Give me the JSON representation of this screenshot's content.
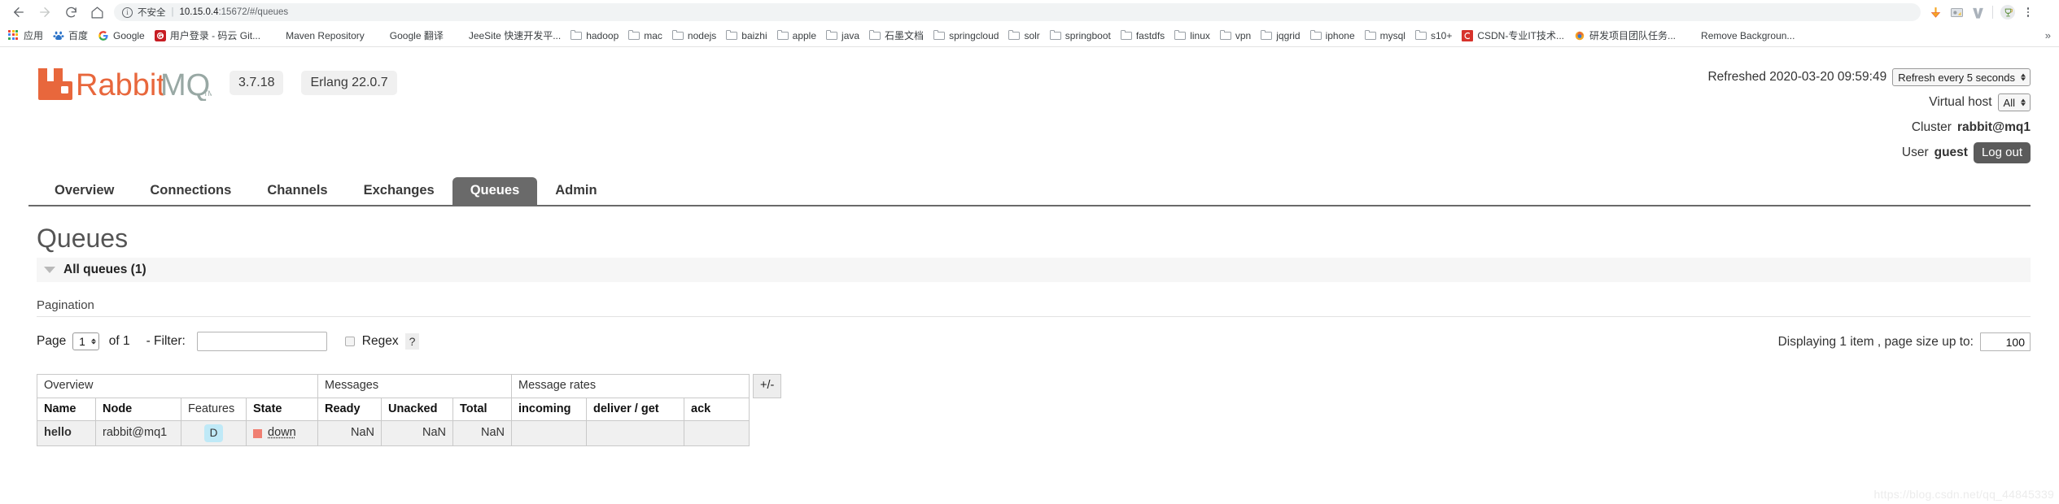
{
  "browser": {
    "nav": {
      "back_icon": "back-arrow-icon",
      "forward_icon": "forward-arrow-icon",
      "reload_icon": "reload-icon",
      "home_icon": "home-icon"
    },
    "omnibox": {
      "info_glyph": "ⓘ",
      "security_label": "不安全",
      "separator": "|",
      "url_host": "10.15.0.4",
      "url_rest": ":15672/#/queues",
      "full_url": "10.15.0.4:15672/#/queues"
    },
    "bookmarks": [
      {
        "label": "应用",
        "icon": "apps-grid-icon"
      },
      {
        "label": "百度",
        "icon": "baidu-icon"
      },
      {
        "label": "Google",
        "icon": "google-icon"
      },
      {
        "label": "用户登录 - 码云 Git...",
        "icon": "gitee-icon"
      },
      {
        "label": "Maven Repository",
        "icon": "globe-icon"
      },
      {
        "label": "Google 翻译",
        "icon": "globe-icon"
      },
      {
        "label": "JeeSite 快速开发平...",
        "icon": "globe-icon"
      },
      {
        "label": "hadoop",
        "icon": "folder-icon"
      },
      {
        "label": "mac",
        "icon": "folder-icon"
      },
      {
        "label": "nodejs",
        "icon": "folder-icon"
      },
      {
        "label": "baizhi",
        "icon": "folder-icon"
      },
      {
        "label": "apple",
        "icon": "folder-icon"
      },
      {
        "label": "java",
        "icon": "folder-icon"
      },
      {
        "label": "石墨文档",
        "icon": "folder-icon"
      },
      {
        "label": "springcloud",
        "icon": "folder-icon"
      },
      {
        "label": "solr",
        "icon": "folder-icon"
      },
      {
        "label": "springboot",
        "icon": "folder-icon"
      },
      {
        "label": "fastdfs",
        "icon": "folder-icon"
      },
      {
        "label": "linux",
        "icon": "folder-icon"
      },
      {
        "label": "vpn",
        "icon": "folder-icon"
      },
      {
        "label": "jqgrid",
        "icon": "folder-icon"
      },
      {
        "label": "iphone",
        "icon": "folder-icon"
      },
      {
        "label": "mysql",
        "icon": "folder-icon"
      },
      {
        "label": "s10+",
        "icon": "folder-icon"
      },
      {
        "label": "CSDN-专业IT技术...",
        "icon": "csdn-icon"
      },
      {
        "label": "研发项目团队任务...",
        "icon": "firefox-icon"
      },
      {
        "label": "Remove Backgroun...",
        "icon": "globe-icon"
      }
    ],
    "bookmarks_overflow": "»"
  },
  "brand": {
    "name": "RabbitMQ",
    "trademark": "TM",
    "version": "3.7.18",
    "erlang": "Erlang 22.0.7",
    "logo_color": "#e8673c",
    "logo_gray": "#8b9a97"
  },
  "status": {
    "refreshed_label": "Refreshed 2020-03-20 09:59:49",
    "refresh_interval": "Refresh every 5 seconds",
    "vhost_label": "Virtual host",
    "vhost_value": "All",
    "cluster_label": "Cluster",
    "cluster_value": "rabbit@mq1",
    "user_label": "User",
    "user_value": "guest",
    "logout_label": "Log out"
  },
  "tabs": [
    {
      "label": "Overview",
      "active": false
    },
    {
      "label": "Connections",
      "active": false
    },
    {
      "label": "Channels",
      "active": false
    },
    {
      "label": "Exchanges",
      "active": false
    },
    {
      "label": "Queues",
      "active": true
    },
    {
      "label": "Admin",
      "active": false
    }
  ],
  "main": {
    "page_title": "Queues",
    "section_title": "All queues (1)",
    "pagination_label": "Pagination",
    "page_label": "Page",
    "page_value": "1",
    "of_label": "of 1",
    "filter_label": "- Filter:",
    "filter_value": "",
    "filter_placeholder": "",
    "regex_label": "Regex",
    "help_label": "?",
    "displaying_label": "Displaying 1 item , page size up to:",
    "page_size_value": "100",
    "plus_minus": "+/-"
  },
  "table": {
    "group_headers": [
      {
        "label": "Overview",
        "span": 4
      },
      {
        "label": "Messages",
        "span": 3
      },
      {
        "label": "Message rates",
        "span": 3
      }
    ],
    "columns": [
      {
        "label": "Name",
        "bold": true
      },
      {
        "label": "Node",
        "bold": true
      },
      {
        "label": "Features",
        "bold": false
      },
      {
        "label": "State",
        "bold": true
      },
      {
        "label": "Ready",
        "bold": true
      },
      {
        "label": "Unacked",
        "bold": true
      },
      {
        "label": "Total",
        "bold": true
      },
      {
        "label": "incoming",
        "bold": true
      },
      {
        "label": "deliver / get",
        "bold": true
      },
      {
        "label": "ack",
        "bold": true
      }
    ],
    "rows": [
      {
        "name": "hello",
        "node": "rabbit@mq1",
        "features": "D",
        "state": "down",
        "state_color": "#f07f72",
        "ready": "NaN",
        "unacked": "NaN",
        "total": "NaN",
        "incoming": "",
        "deliver_get": "",
        "ack": ""
      }
    ]
  },
  "watermark": "https://blog.csdn.net/qq_44845339"
}
